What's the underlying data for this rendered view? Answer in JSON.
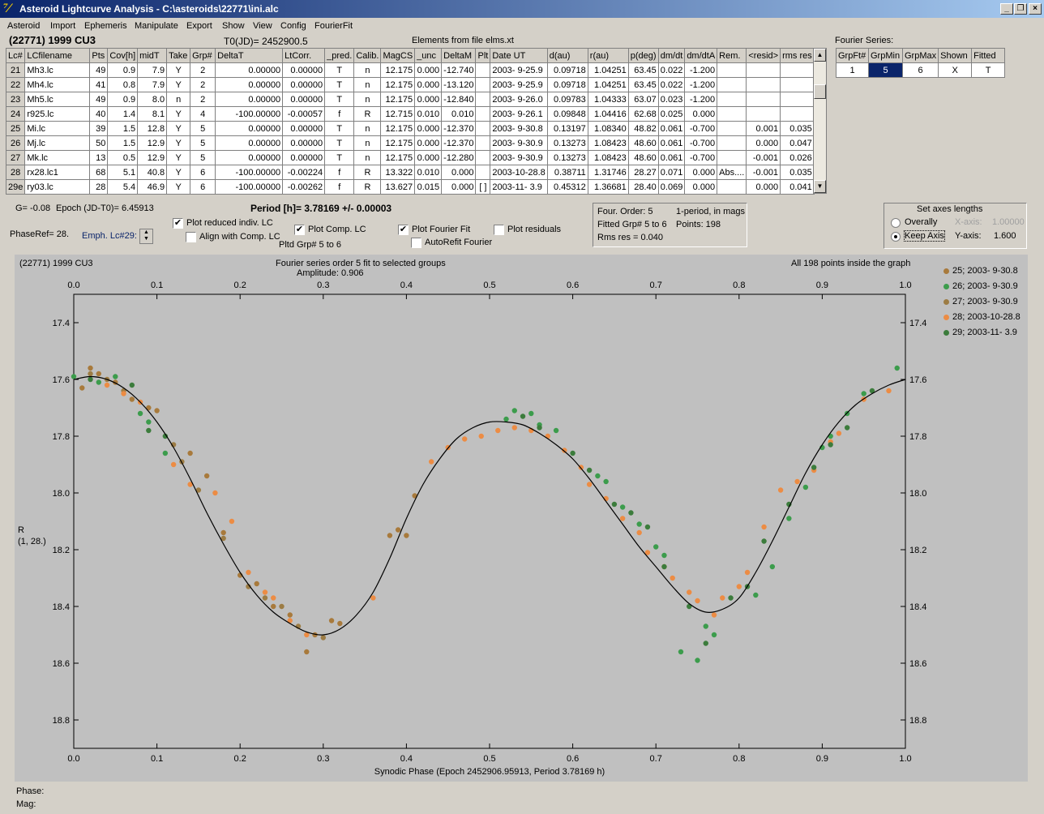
{
  "window": {
    "title": "Asteroid Lightcurve Analysis - C:\\asteroids\\22771\\ini.alc"
  },
  "menu": [
    "Asteroid",
    "Import",
    "Ephemeris",
    "Manipulate",
    "Export",
    "Show",
    "View",
    "Config",
    "FourierFit"
  ],
  "header": {
    "asteroid": "(22771) 1999 CU3",
    "t0": "T0(JD)= 2452900.5",
    "elements": "Elements from file elms.xt",
    "fourier_series_label": "Fourier Series:"
  },
  "table": {
    "columns": [
      "Lc#",
      "LCfilename",
      "Pts",
      "Cov[h]",
      "midT",
      "Take",
      "Grp#",
      "DeltaT",
      "LtCorr.",
      "_pred.",
      "Calib.",
      "MagCS",
      "_unc",
      "DeltaM",
      "Plt",
      "Date UT",
      "d(au)",
      "r(au)",
      "p(deg)",
      "dm/dt",
      "dm/dtA",
      "Rem.",
      "<resid>",
      "rms res"
    ],
    "rows": [
      [
        "21",
        "Mh3.lc",
        "49",
        "0.9",
        "7.9",
        "Y",
        "2",
        "0.00000",
        "0.00000",
        "T",
        "n",
        "12.175",
        "0.000",
        "-12.740",
        "",
        "2003- 9-25.9",
        "0.09718",
        "1.04251",
        "63.45",
        "0.022",
        "-1.200",
        "",
        "",
        ""
      ],
      [
        "22",
        "Mh4.lc",
        "41",
        "0.8",
        "7.9",
        "Y",
        "2",
        "0.00000",
        "0.00000",
        "T",
        "n",
        "12.175",
        "0.000",
        "-13.120",
        "",
        "2003- 9-25.9",
        "0.09718",
        "1.04251",
        "63.45",
        "0.022",
        "-1.200",
        "",
        "",
        ""
      ],
      [
        "23",
        "Mh5.lc",
        "49",
        "0.9",
        "8.0",
        "n",
        "2",
        "0.00000",
        "0.00000",
        "T",
        "n",
        "12.175",
        "0.000",
        "-12.840",
        "",
        "2003- 9-26.0",
        "0.09783",
        "1.04333",
        "63.07",
        "0.023",
        "-1.200",
        "",
        "",
        ""
      ],
      [
        "24",
        "r925.lc",
        "40",
        "1.4",
        "8.1",
        "Y",
        "4",
        "-100.00000",
        "-0.00057",
        "f",
        "R",
        "12.715",
        "0.010",
        "0.010",
        "",
        "2003- 9-26.1",
        "0.09848",
        "1.04416",
        "62.68",
        "0.025",
        "0.000",
        "",
        "",
        ""
      ],
      [
        "25",
        "Mi.lc",
        "39",
        "1.5",
        "12.8",
        "Y",
        "5",
        "0.00000",
        "0.00000",
        "T",
        "n",
        "12.175",
        "0.000",
        "-12.370",
        "",
        "2003- 9-30.8",
        "0.13197",
        "1.08340",
        "48.82",
        "0.061",
        "-0.700",
        "",
        "0.001",
        "0.035"
      ],
      [
        "26",
        "Mj.lc",
        "50",
        "1.5",
        "12.9",
        "Y",
        "5",
        "0.00000",
        "0.00000",
        "T",
        "n",
        "12.175",
        "0.000",
        "-12.370",
        "",
        "2003- 9-30.9",
        "0.13273",
        "1.08423",
        "48.60",
        "0.061",
        "-0.700",
        "",
        "0.000",
        "0.047"
      ],
      [
        "27",
        "Mk.lc",
        "13",
        "0.5",
        "12.9",
        "Y",
        "5",
        "0.00000",
        "0.00000",
        "T",
        "n",
        "12.175",
        "0.000",
        "-12.280",
        "",
        "2003- 9-30.9",
        "0.13273",
        "1.08423",
        "48.60",
        "0.061",
        "-0.700",
        "",
        "-0.001",
        "0.026"
      ],
      [
        "28",
        "rx28.lc1",
        "68",
        "5.1",
        "40.8",
        "Y",
        "6",
        "-100.00000",
        "-0.00224",
        "f",
        "R",
        "13.322",
        "0.010",
        "0.000",
        "",
        "2003-10-28.8",
        "0.38711",
        "1.31746",
        "28.27",
        "0.071",
        "0.000",
        "Abs....",
        "-0.001",
        "0.035"
      ],
      [
        "29e",
        "ry03.lc",
        "28",
        "5.4",
        "46.9",
        "Y",
        "6",
        "-100.00000",
        "-0.00262",
        "f",
        "R",
        "13.627",
        "0.015",
        "0.000",
        "[ ]",
        "2003-11- 3.9",
        "0.45312",
        "1.36681",
        "28.40",
        "0.069",
        "0.000",
        "",
        "0.000",
        "0.041"
      ]
    ]
  },
  "fourier_table": {
    "columns": [
      "GrpFt#",
      "GrpMin",
      "GrpMax",
      "Shown",
      "Fitted"
    ],
    "row": [
      "1",
      "5",
      "6",
      "X",
      "T"
    ]
  },
  "controls": {
    "g_label": "G= -0.08",
    "epoch_label": "Epoch (JD-T0)= 6.45913",
    "period_label": "Period [h]= 3.78169 +/- 0.00003",
    "phaseref_label": "PhaseRef= 28.",
    "emph_label": "Emph. Lc#29:",
    "plot_reduced": "Plot reduced indiv. LC",
    "align_comp": "Align with Comp. LC",
    "plot_comp": "Plot Comp. LC",
    "pltd_grp": "Pltd Grp#  5  to   6",
    "plot_fourier": "Plot Fourier Fit",
    "autorefit": "AutoRefit Fourier",
    "plot_residuals": "Plot residuals",
    "four_order": "Four. Order:  5",
    "one_period": "1-period, in mags",
    "fitted_grp": "Fitted Grp# 5 to 6",
    "points": "Points: 198",
    "rms_res": "Rms res     = 0.040",
    "axes_title": "Set axes lengths",
    "overally": "Overally",
    "keep_axis": "Keep Axis",
    "xaxis_label": "X-axis:",
    "xaxis_value": "1.00000",
    "yaxis_label": "Y-axis:",
    "yaxis_value": "1.600"
  },
  "graph": {
    "title_left": "(22771) 1999 CU3",
    "title_center": "Fourier series order 5 fit to selected groups",
    "amplitude": "Amplitude: 0.906",
    "title_right": "All 198 points inside the graph",
    "ylabel_1": "R",
    "ylabel_2": "(1, 28.)",
    "xlabel": "Synodic Phase (Epoch 2452906.95913, Period 3.78169 h)",
    "phase_label": "Phase:",
    "mag_label": "Mag:"
  },
  "chart_data": {
    "type": "scatter",
    "xlim": [
      0.0,
      1.0
    ],
    "ylim": [
      18.9,
      17.3
    ],
    "y_inverted": true,
    "xticks": [
      "0.0",
      "0.1",
      "0.2",
      "0.3",
      "0.4",
      "0.5",
      "0.6",
      "0.7",
      "0.8",
      "0.9",
      "1.0"
    ],
    "yticks": [
      "17.4",
      "17.6",
      "17.8",
      "18.0",
      "18.2",
      "18.4",
      "18.6",
      "18.8"
    ],
    "xlabel": "Synodic Phase (Epoch 2452906.95913, Period 3.78169 h)",
    "ylabel": "R",
    "legend_position": "right",
    "fourier_curve": {
      "x": [
        0.0,
        0.02,
        0.04,
        0.06,
        0.08,
        0.1,
        0.12,
        0.14,
        0.16,
        0.18,
        0.2,
        0.22,
        0.24,
        0.26,
        0.28,
        0.3,
        0.32,
        0.34,
        0.36,
        0.38,
        0.4,
        0.42,
        0.44,
        0.46,
        0.48,
        0.5,
        0.52,
        0.54,
        0.56,
        0.58,
        0.6,
        0.62,
        0.64,
        0.66,
        0.68,
        0.7,
        0.72,
        0.74,
        0.76,
        0.78,
        0.8,
        0.82,
        0.84,
        0.86,
        0.88,
        0.9,
        0.92,
        0.94,
        0.96,
        0.98,
        1.0
      ],
      "y": [
        17.6,
        17.59,
        17.6,
        17.63,
        17.68,
        17.75,
        17.84,
        17.95,
        18.07,
        18.18,
        18.28,
        18.36,
        18.42,
        18.46,
        18.49,
        18.5,
        18.48,
        18.43,
        18.35,
        18.23,
        18.09,
        17.97,
        17.88,
        17.81,
        17.77,
        17.75,
        17.75,
        17.76,
        17.79,
        17.83,
        17.88,
        17.95,
        18.03,
        18.11,
        18.19,
        18.26,
        18.33,
        18.39,
        18.42,
        18.41,
        18.37,
        18.28,
        18.17,
        18.05,
        17.93,
        17.83,
        17.75,
        17.69,
        17.65,
        17.62,
        17.6
      ]
    },
    "series": [
      {
        "name": "25; 2003- 9-30.8",
        "color": "#a87a3c",
        "x": [
          0.01,
          0.02,
          0.03,
          0.05,
          0.07,
          0.09,
          0.1,
          0.14,
          0.16,
          0.18,
          0.2,
          0.22,
          0.24,
          0.26,
          0.28,
          0.29,
          0.31,
          0.32,
          0.38,
          0.39,
          0.4,
          0.41
        ],
        "y": [
          17.63,
          17.56,
          17.58,
          17.61,
          17.67,
          17.7,
          17.71,
          17.86,
          17.94,
          18.14,
          18.29,
          18.32,
          18.4,
          18.43,
          18.56,
          18.5,
          18.45,
          18.46,
          18.15,
          18.13,
          18.15,
          18.01
        ]
      },
      {
        "name": "26; 2003- 9-30.9",
        "color": "#3c9c4c",
        "x": [
          0.0,
          0.03,
          0.05,
          0.08,
          0.09,
          0.11,
          0.52,
          0.53,
          0.55,
          0.56,
          0.58,
          0.63,
          0.64,
          0.66,
          0.68,
          0.7,
          0.71,
          0.73,
          0.75,
          0.76,
          0.77,
          0.82,
          0.84,
          0.86,
          0.88,
          0.9,
          0.91,
          0.93,
          0.95,
          0.99
        ],
        "y": [
          17.59,
          17.61,
          17.59,
          17.72,
          17.75,
          17.86,
          17.74,
          17.71,
          17.72,
          17.76,
          17.78,
          17.94,
          17.96,
          18.05,
          18.11,
          18.19,
          18.22,
          18.56,
          18.59,
          18.47,
          18.5,
          18.36,
          18.26,
          18.09,
          17.98,
          17.84,
          17.8,
          17.72,
          17.65,
          17.56
        ]
      },
      {
        "name": "27; 2003- 9-30.9",
        "color": "#9c7c44",
        "x": [
          0.02,
          0.04,
          0.06,
          0.12,
          0.13,
          0.15,
          0.18,
          0.21,
          0.23,
          0.25,
          0.27,
          0.3
        ],
        "y": [
          17.58,
          17.6,
          17.64,
          17.83,
          17.89,
          17.99,
          18.16,
          18.33,
          18.37,
          18.4,
          18.47,
          18.51
        ]
      },
      {
        "name": "28; 2003-10-28.8",
        "color": "#ec8c44",
        "x": [
          0.04,
          0.06,
          0.08,
          0.12,
          0.14,
          0.17,
          0.19,
          0.21,
          0.23,
          0.24,
          0.26,
          0.28,
          0.36,
          0.43,
          0.45,
          0.47,
          0.49,
          0.51,
          0.53,
          0.55,
          0.57,
          0.59,
          0.61,
          0.62,
          0.64,
          0.66,
          0.68,
          0.69,
          0.71,
          0.72,
          0.74,
          0.75,
          0.77,
          0.78,
          0.8,
          0.81,
          0.83,
          0.85,
          0.87,
          0.89,
          0.91,
          0.92,
          0.95,
          0.98
        ],
        "y": [
          17.62,
          17.65,
          17.68,
          17.9,
          17.97,
          18.0,
          18.1,
          18.28,
          18.35,
          18.37,
          18.45,
          18.5,
          18.37,
          17.89,
          17.84,
          17.81,
          17.8,
          17.78,
          17.77,
          17.78,
          17.8,
          17.85,
          17.91,
          17.97,
          18.02,
          18.09,
          18.14,
          18.21,
          18.26,
          18.3,
          18.35,
          18.38,
          18.43,
          18.37,
          18.33,
          18.28,
          18.12,
          17.99,
          17.96,
          17.92,
          17.82,
          17.79,
          17.67,
          17.64
        ]
      },
      {
        "name": "29; 2003-11- 3.9",
        "color": "#3c7c3c",
        "x": [
          0.02,
          0.07,
          0.09,
          0.11,
          0.54,
          0.56,
          0.6,
          0.62,
          0.65,
          0.67,
          0.69,
          0.71,
          0.74,
          0.76,
          0.79,
          0.81,
          0.83,
          0.86,
          0.89,
          0.91,
          0.93,
          0.96
        ],
        "y": [
          17.6,
          17.62,
          17.78,
          17.8,
          17.73,
          17.77,
          17.86,
          17.92,
          18.04,
          18.07,
          18.12,
          18.26,
          18.4,
          18.53,
          18.37,
          18.33,
          18.17,
          18.04,
          17.91,
          17.83,
          17.77,
          17.64
        ]
      }
    ]
  }
}
